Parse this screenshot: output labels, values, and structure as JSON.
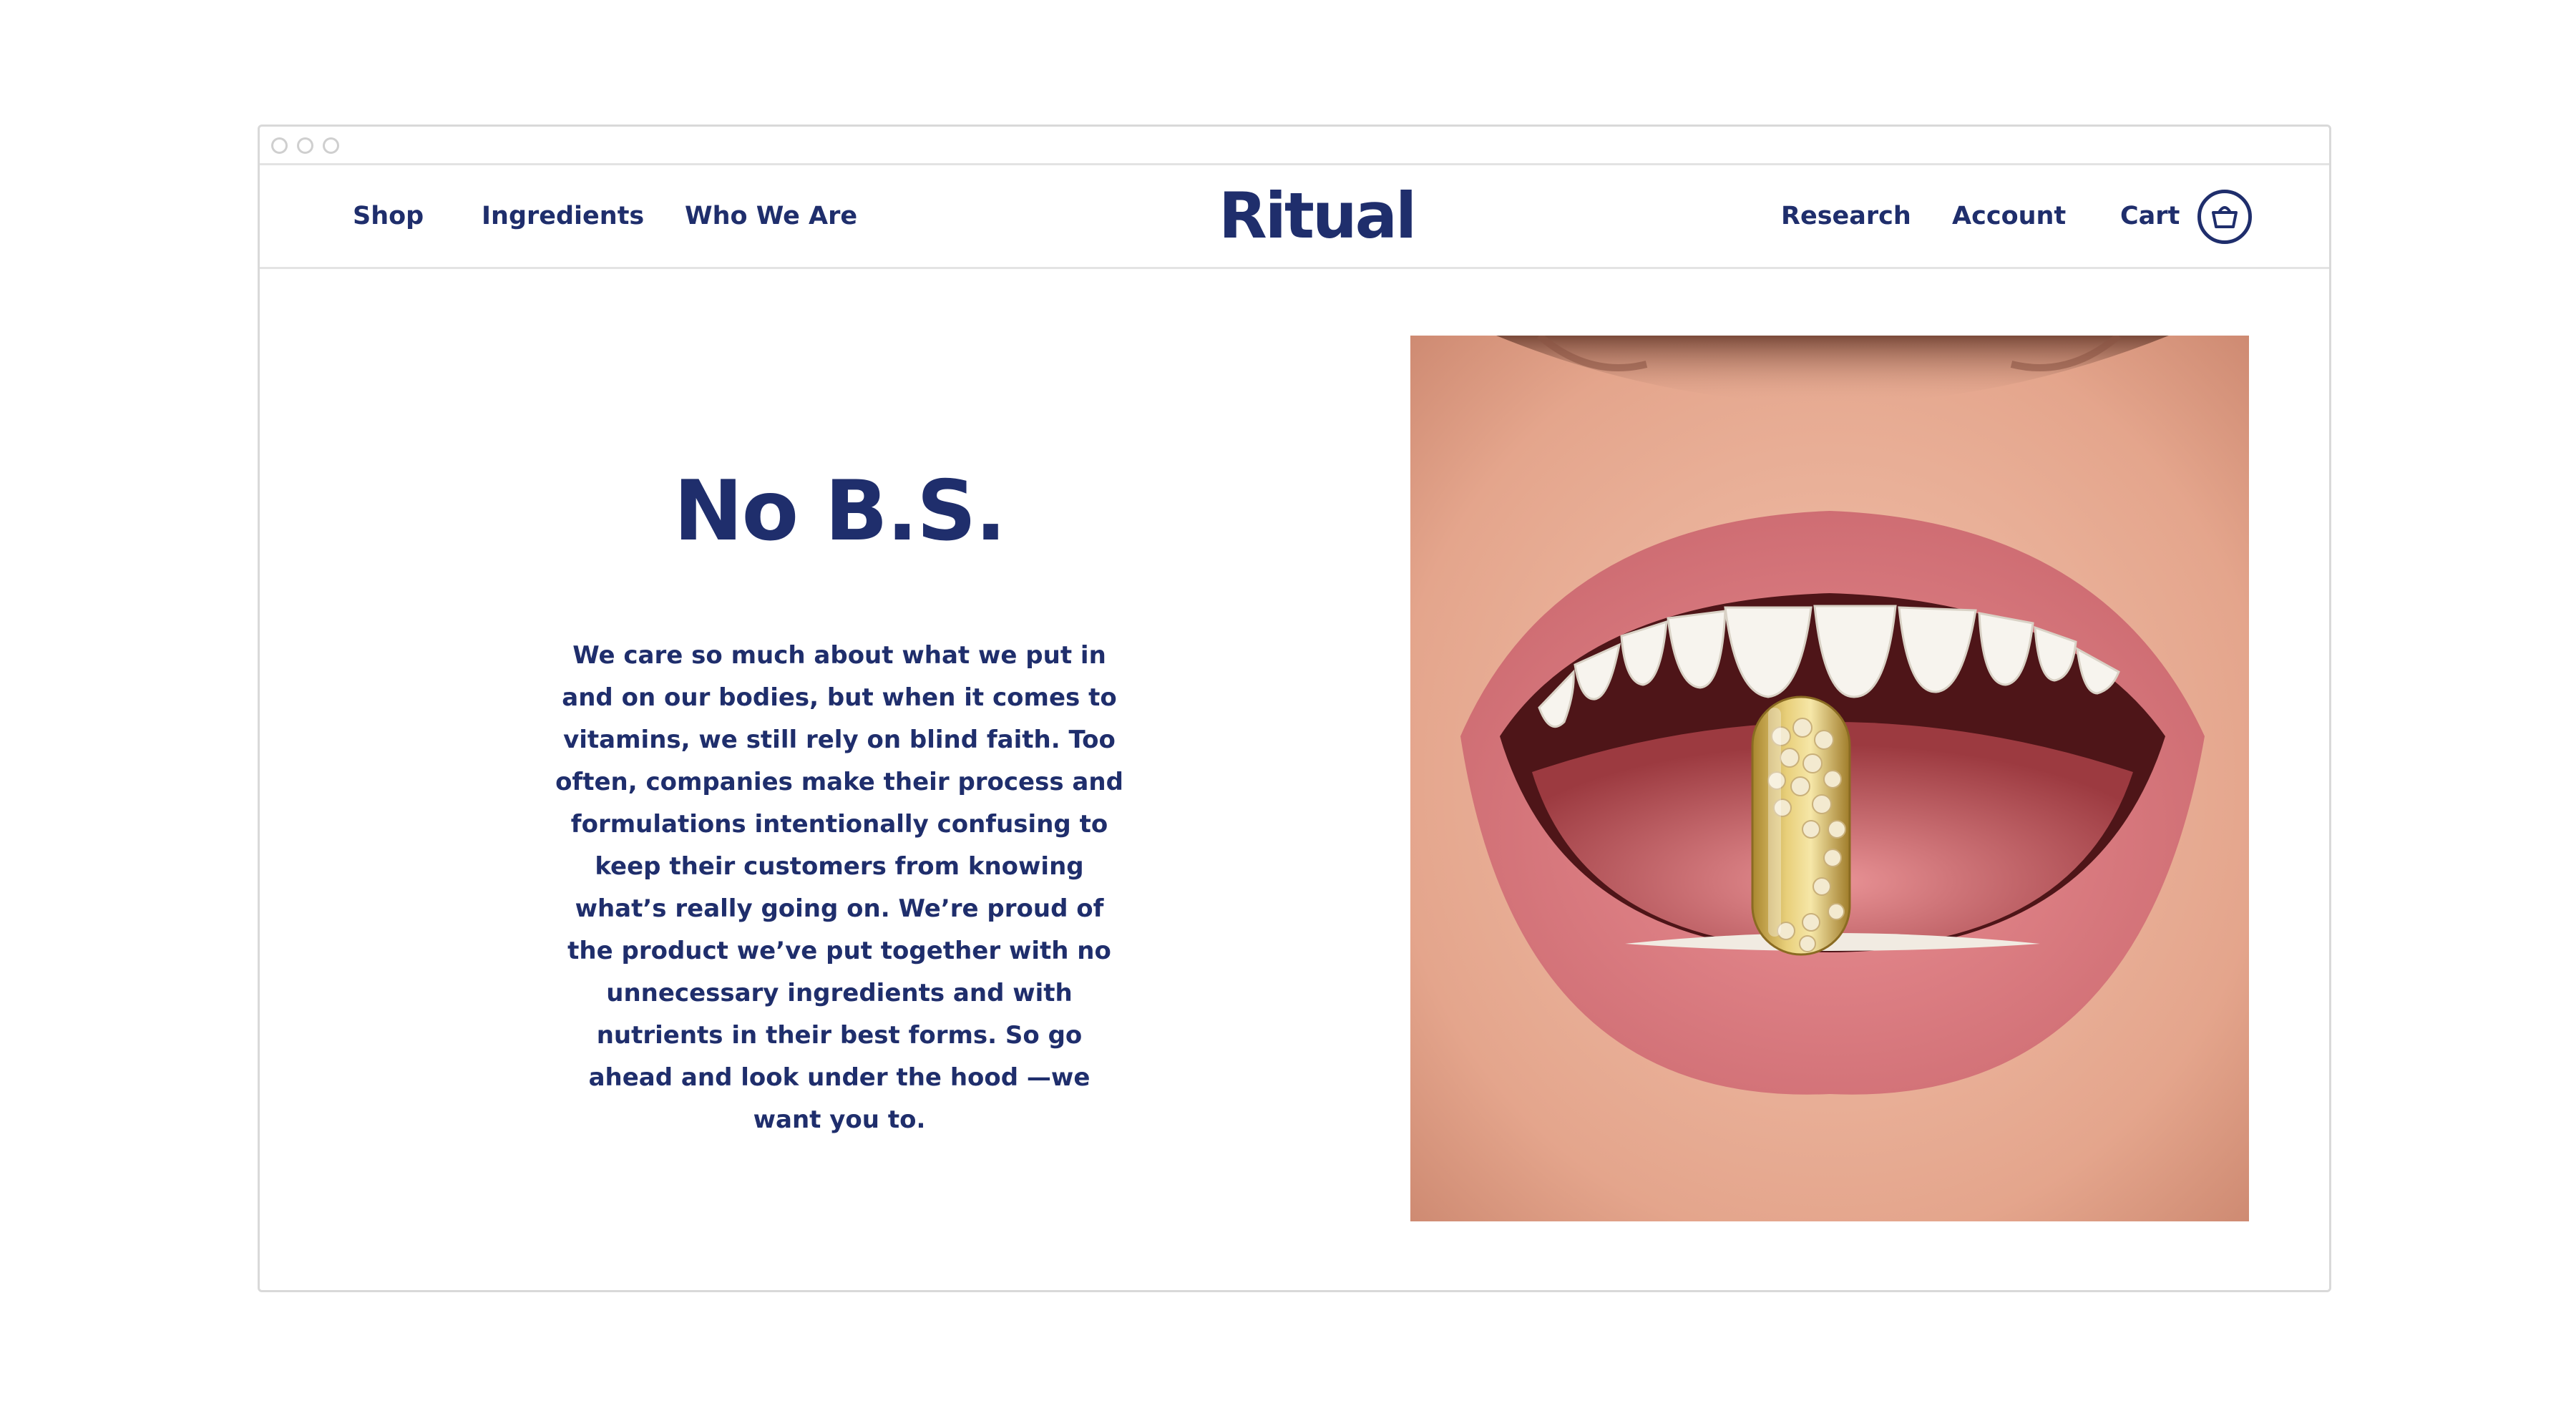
{
  "nav": {
    "left_items": [
      "Shop",
      "Ingredients",
      "Who We Are"
    ],
    "logo": "Ritual",
    "right_items": [
      "Research",
      "Account",
      "Cart"
    ]
  },
  "icons": {
    "cart": "basket-icon"
  },
  "hero": {
    "headline": "No B.S.",
    "body": "We care so much about what we put in and on our bodies, but when it comes to vitamins, we still rely on blind faith. Too often, companies make their process and formulations intentionally confusing to keep their customers from knowing what’s really going on. We’re proud of the product we’ve put together with no unnecessary ingredients and with nutrients in their best forms. So go ahead and look under the hood —we want you to."
  },
  "colors": {
    "brand": "#1f2e6c",
    "border": "#d9d9d9",
    "background": "#ffffff"
  }
}
